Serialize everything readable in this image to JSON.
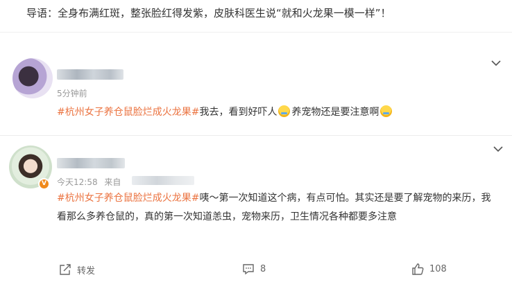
{
  "intro": "导语：全身布满红斑，整张脸红得发紫，皮肤科医生说“就和火龙果一模一样”！",
  "comments": [
    {
      "time": "5分钟前",
      "source": "",
      "hashtag": "#杭州女子养仓鼠脸烂成火龙果#",
      "text_a": "我去，看到好吓人",
      "text_b": "养宠物还是要注意啊"
    },
    {
      "time": "今天12:58",
      "source": "来自",
      "hashtag": "#杭州女子养仓鼠脸烂成火龙果#",
      "text": "咦～第一次知道这个病，有点可怕。其实还是要了解宠物的来历，我看那么多养仓鼠的，真的第一次知道恙虫，宠物来历，卫生情况各种都要多注意",
      "verified_badge": "V"
    }
  ],
  "actions": {
    "share_label": "转发",
    "comment_count": "8",
    "like_count": "108"
  },
  "icons": {
    "expand": "chevron-down-icon",
    "share": "share-icon",
    "comment": "comment-icon",
    "like": "thumbs-up-icon",
    "emoji": "crying-laughing-emoji-icon"
  },
  "colors": {
    "hashtag": "#eb7340",
    "text": "#333333",
    "meta": "#999999",
    "badge": "#f08a1c"
  }
}
